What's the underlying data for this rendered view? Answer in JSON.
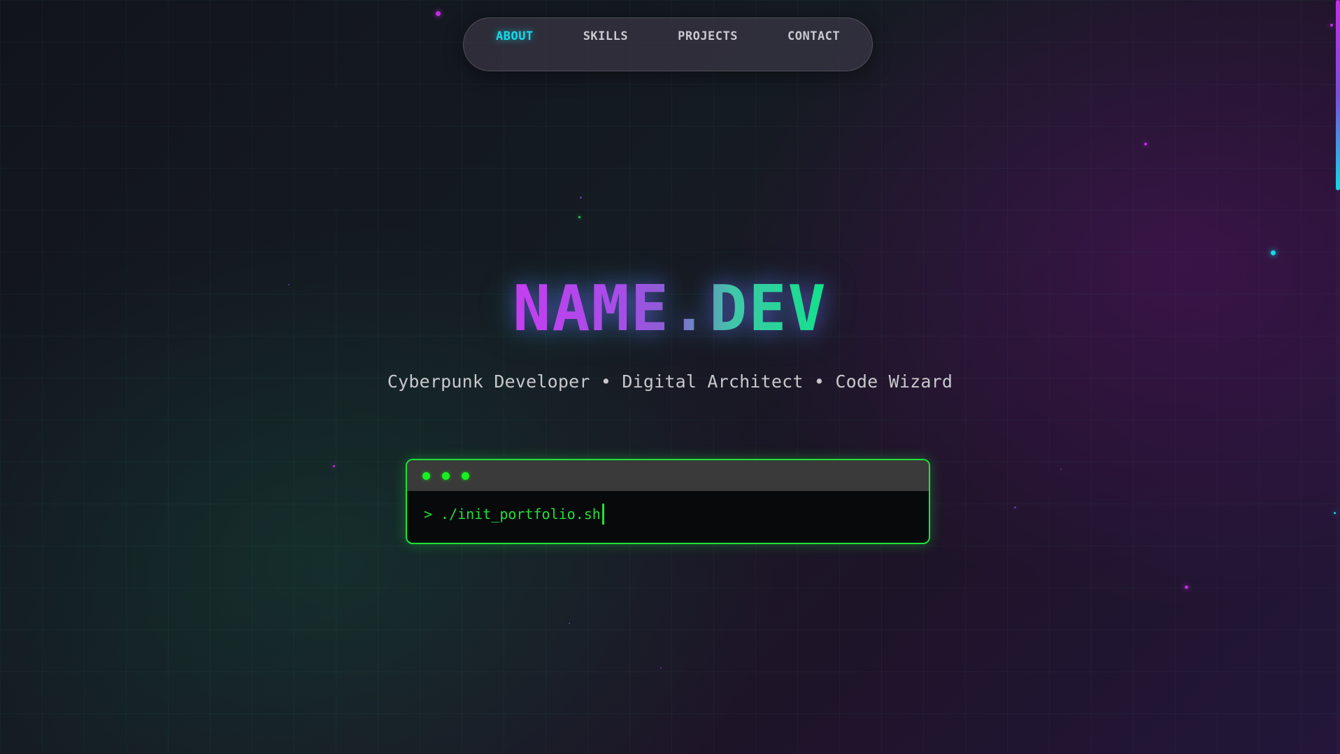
{
  "nav": {
    "items": [
      {
        "label": "ABOUT",
        "active": true
      },
      {
        "label": "SKILLS",
        "active": false
      },
      {
        "label": "PROJECTS",
        "active": false
      },
      {
        "label": "CONTACT",
        "active": false
      }
    ]
  },
  "hero": {
    "title": "NAME.DEV",
    "subtitle": "Cyberpunk Developer • Digital Architect • Code Wizard"
  },
  "terminal": {
    "prompt": ">",
    "command": "./init_portfolio.sh"
  },
  "colors": {
    "accent_cyan": "#19d8e8",
    "accent_pink": "#c63ef0",
    "accent_green": "#1fe03a"
  }
}
